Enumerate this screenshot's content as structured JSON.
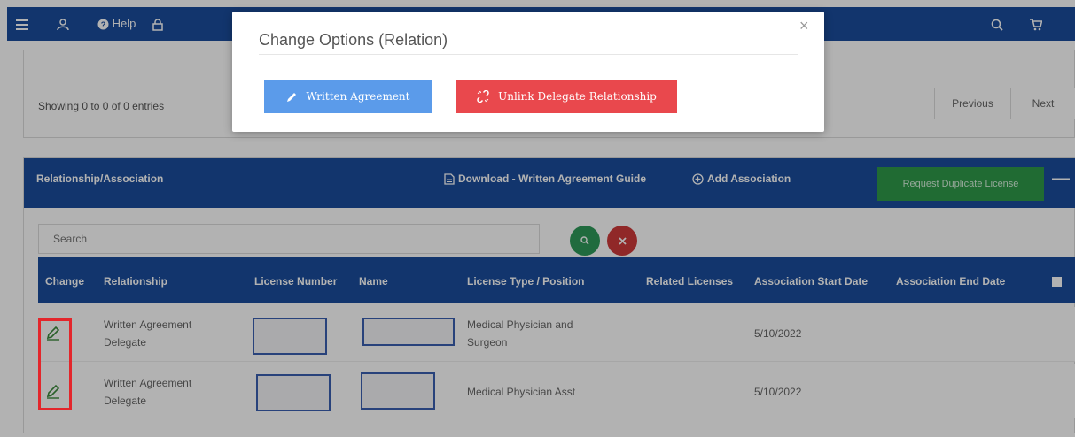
{
  "header": {
    "help_label": "Help"
  },
  "entries_card": {
    "showing_text": "Showing 0 to 0 of 0 entries",
    "previous_label": "Previous",
    "next_label": "Next"
  },
  "relation_card": {
    "title": "Relationship/Association",
    "download_label": "Download - Written Agreement Guide",
    "add_label": "Add Association",
    "duplicate_label": "Request Duplicate License",
    "search_placeholder": "Search",
    "columns": [
      "Change",
      "Relationship",
      "License Number",
      "Name",
      "License Type / Position",
      "Related Licenses",
      "Association Start Date",
      "Association End Date"
    ],
    "rows": [
      {
        "relationship": "Written Agreement Delegate",
        "license_type": "Medical Physician and Surgeon",
        "related": "",
        "start_date": "5/10/2022",
        "end_date": ""
      },
      {
        "relationship": "Written Agreement Delegate",
        "license_type": "Medical Physician Asst",
        "related": "",
        "start_date": "5/10/2022",
        "end_date": ""
      }
    ]
  },
  "modal": {
    "title": "Change Options (Relation)",
    "close_glyph": "×",
    "written_agreement_label": "Written Agreement",
    "unlink_label": "Unlink Delegate Relationship"
  },
  "colors": {
    "header_blue": "#1a4d9c",
    "written_btn": "#5b9bea",
    "unlink_btn": "#e9484d",
    "duplicate_btn": "#2e9a4a",
    "search_btn": "#2e9a5a",
    "clear_btn": "#cf3a3a",
    "highlight": "#e3262b"
  }
}
